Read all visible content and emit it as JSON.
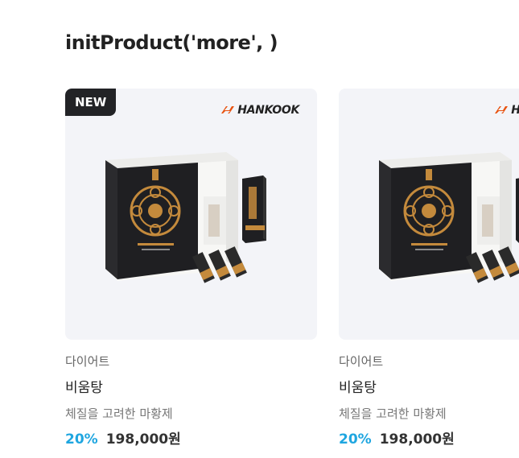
{
  "section": {
    "title": "initProduct('more', )"
  },
  "products": [
    {
      "badge": "NEW",
      "brand": "HANKOOK",
      "category": "다이어트",
      "name": "비움탕",
      "description": "체질을 고려한 마황제",
      "discount": "20%",
      "price": "198,000원"
    },
    {
      "badge": "",
      "brand": "HANKOOK",
      "category": "다이어트",
      "name": "비움탕",
      "description": "체질을 고려한 마황제",
      "discount": "20%",
      "price": "198,000원"
    }
  ],
  "colors": {
    "accent_discount": "#1fa6e0",
    "badge_bg": "#222326",
    "brand_orange": "#e8520f",
    "thumb_bg": "#f3f4f8"
  }
}
